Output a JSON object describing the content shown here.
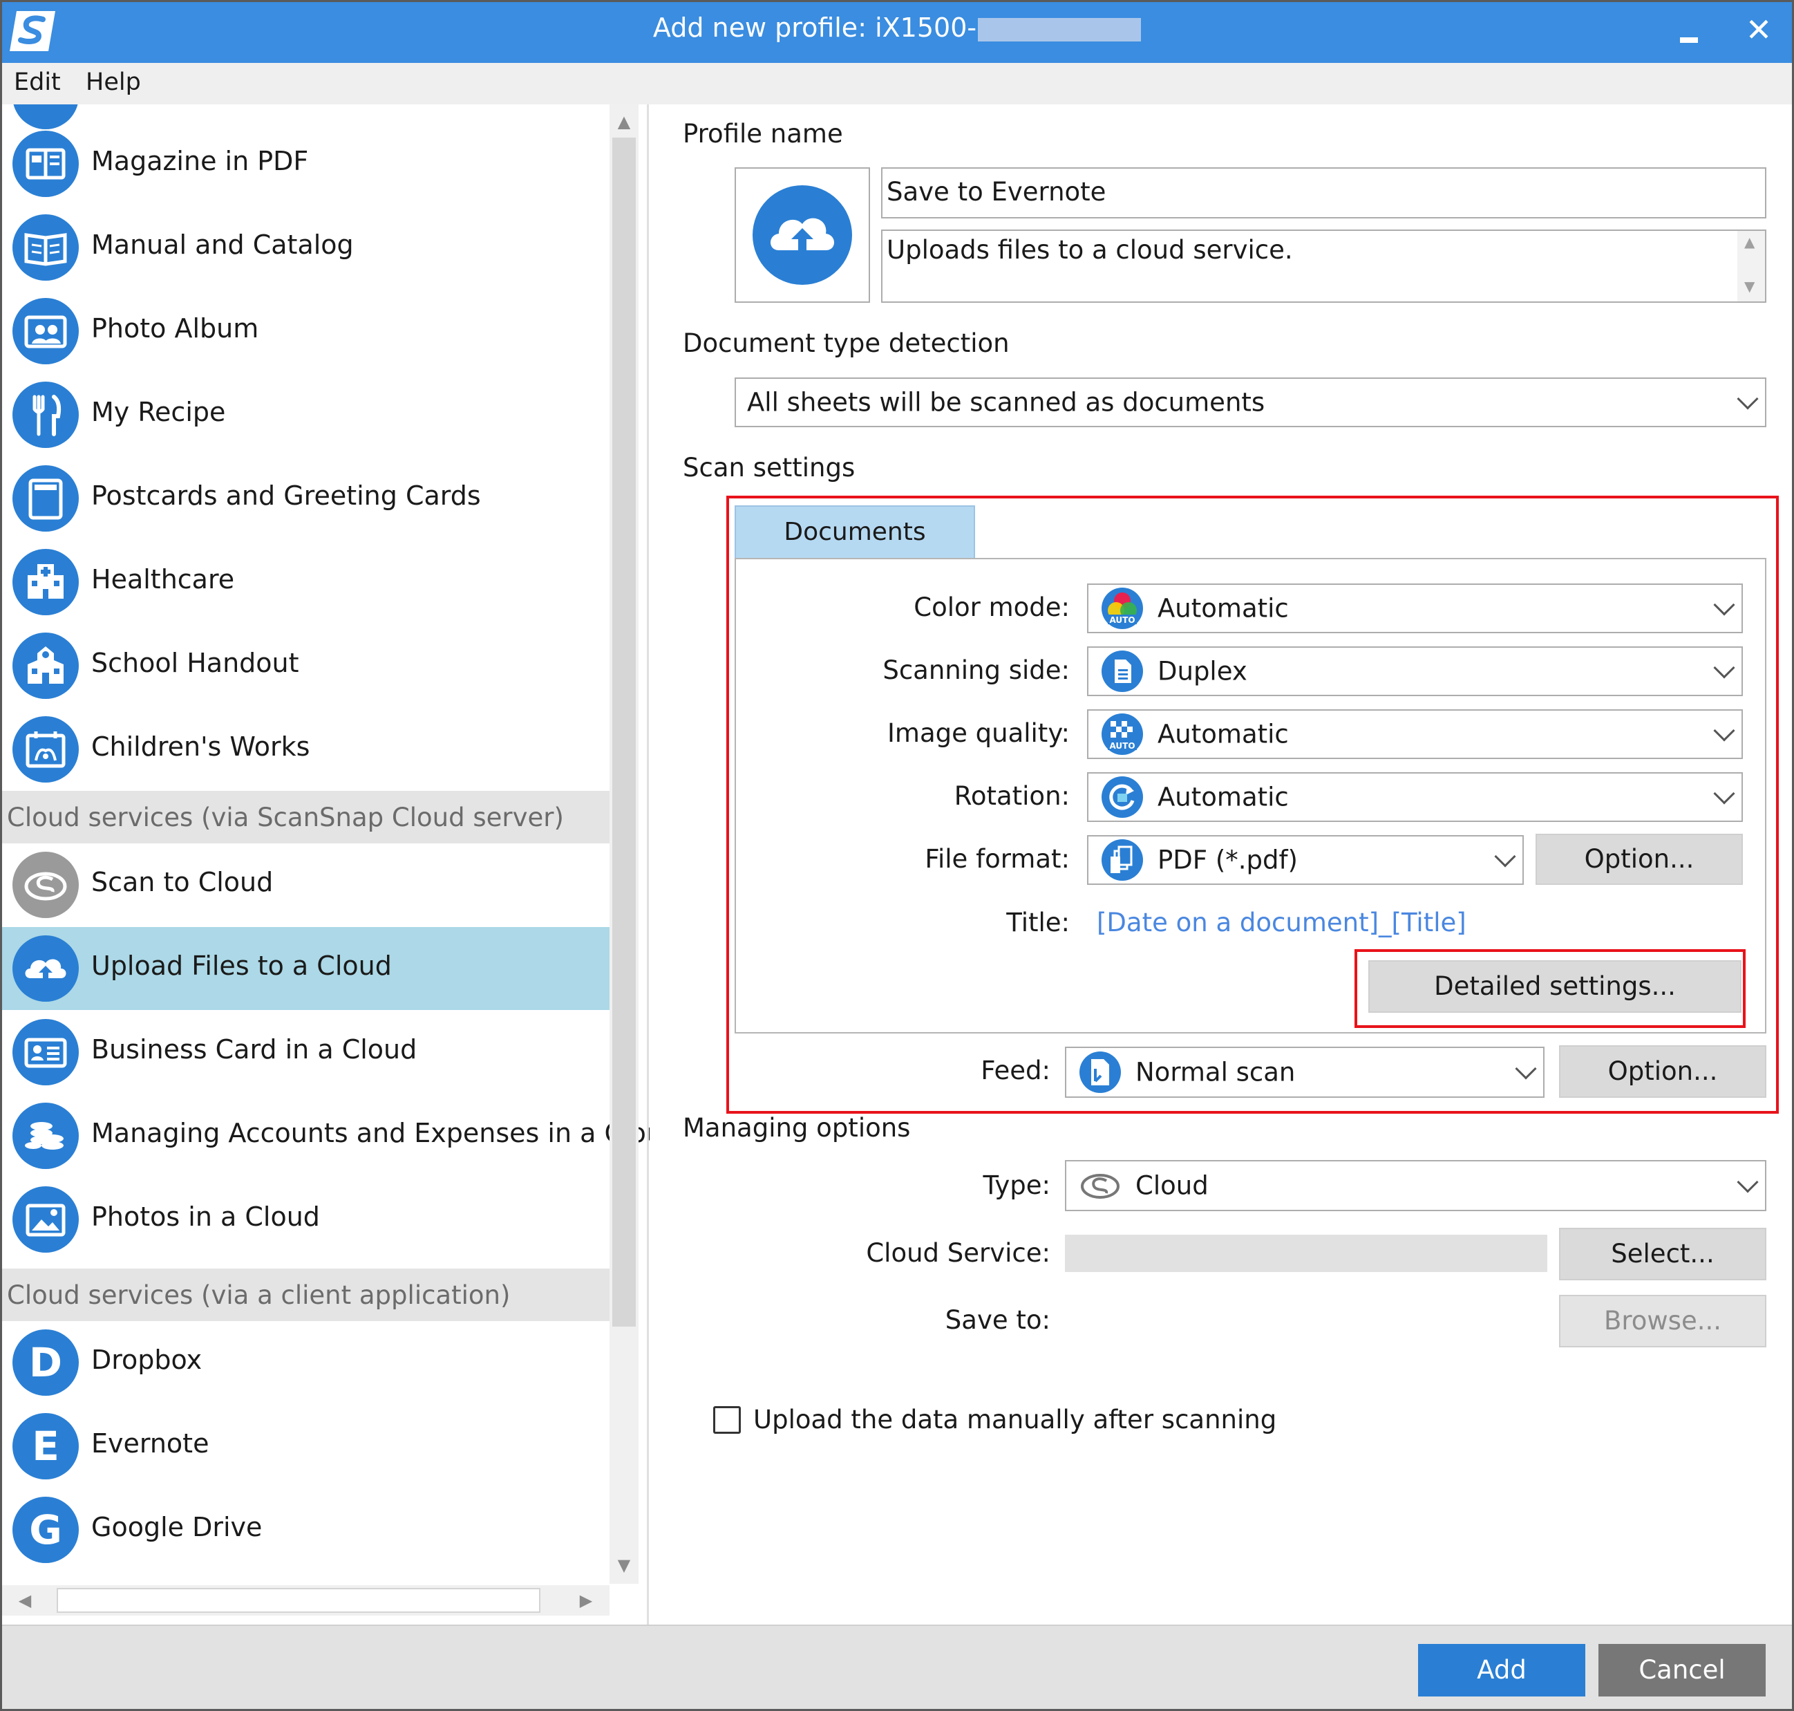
{
  "window": {
    "title": "Add new profile: iX1500-",
    "minimize_icon": "minimize-icon",
    "close_icon": "close-icon",
    "close_glyph": "✕"
  },
  "menu": {
    "items": [
      "Edit",
      "Help"
    ]
  },
  "sidebar": {
    "items": [
      {
        "label": "Magazine in PDF",
        "icon": "magazine-icon"
      },
      {
        "label": "Manual and Catalog",
        "icon": "catalog-icon"
      },
      {
        "label": "Photo Album",
        "icon": "photo-album-icon"
      },
      {
        "label": "My Recipe",
        "icon": "recipe-icon"
      },
      {
        "label": "Postcards and Greeting Cards",
        "icon": "postcard-icon"
      },
      {
        "label": "Healthcare",
        "icon": "healthcare-icon"
      },
      {
        "label": "School Handout",
        "icon": "school-icon"
      },
      {
        "label": "Children's Works",
        "icon": "childrens-works-icon"
      },
      {
        "label": "Scan to Cloud",
        "icon": "scan-to-cloud-icon"
      },
      {
        "label": "Upload Files to a Cloud",
        "icon": "cloud-upload-icon",
        "selected": true
      },
      {
        "label": "Business Card in a Cloud",
        "icon": "business-card-icon"
      },
      {
        "label": "Managing Accounts and Expenses in a Clou",
        "icon": "expenses-icon"
      },
      {
        "label": "Photos in a Cloud",
        "icon": "photos-cloud-icon"
      },
      {
        "label": "Dropbox",
        "icon": "dropbox-icon",
        "letter": "D"
      },
      {
        "label": "Evernote",
        "icon": "evernote-icon",
        "letter": "E"
      },
      {
        "label": "Google Drive",
        "icon": "google-drive-icon",
        "letter": "G"
      }
    ],
    "headers": [
      "Cloud services (via ScanSnap Cloud server)",
      "Cloud services (via a client application)"
    ],
    "scroll_up_glyph": "▲",
    "scroll_down_glyph": "▼",
    "scroll_left_glyph": "◀",
    "scroll_right_glyph": "▶"
  },
  "profile": {
    "section_label": "Profile name",
    "name_value": "Save to Evernote",
    "description_value": "Uploads files to a cloud service.",
    "icon": "cloud-upload-icon"
  },
  "document_type": {
    "section_label": "Document type detection",
    "selected": "All sheets will be scanned as documents"
  },
  "scan_settings": {
    "section_label": "Scan settings",
    "tab_label": "Documents",
    "color_mode_label": "Color mode:",
    "color_mode_value": "Automatic",
    "scanning_side_label": "Scanning side:",
    "scanning_side_value": "Duplex",
    "image_quality_label": "Image quality:",
    "image_quality_value": "Automatic",
    "rotation_label": "Rotation:",
    "rotation_value": "Automatic",
    "file_format_label": "File format:",
    "file_format_value": "PDF (*.pdf)",
    "option_button": "Option...",
    "title_label": "Title:",
    "title_value": "[Date on a document]_[Title]",
    "detailed_button": "Detailed settings...",
    "feed_label": "Feed:",
    "feed_value": "Normal scan",
    "feed_option_button": "Option...",
    "highlight_color": "#e8131b"
  },
  "managing": {
    "section_label": "Managing options",
    "type_label": "Type:",
    "type_value": "Cloud",
    "cloud_service_label": "Cloud Service:",
    "cloud_service_value": "",
    "select_button": "Select...",
    "save_to_label": "Save to:",
    "browse_button": "Browse...",
    "checkbox_label": "Upload the data manually after scanning"
  },
  "footer": {
    "add_button": "Add",
    "cancel_button": "Cancel"
  },
  "colors": {
    "accent": "#3a8de0",
    "icon_blue": "#2a7fd4",
    "selected_row": "#acd8e7",
    "link": "#4a87e0"
  }
}
